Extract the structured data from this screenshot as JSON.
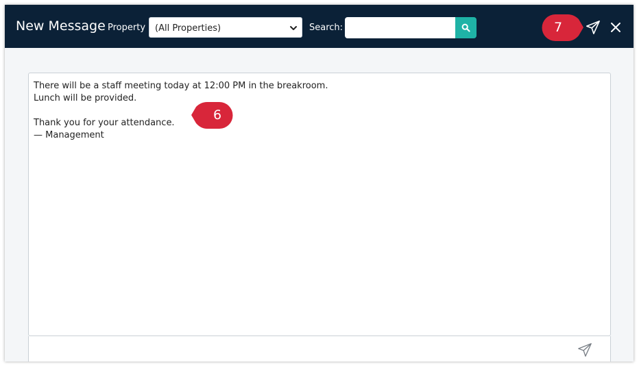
{
  "header": {
    "title": "New Message",
    "property_label": "Property",
    "property_selected": "(All Properties)",
    "search_label": "Search:",
    "search_value": "",
    "search_placeholder": ""
  },
  "callouts": {
    "send_step": "7",
    "message_step": "6"
  },
  "message": {
    "body": "There will be a staff meeting today at 12:00 PM in the breakroom.\nLunch will be provided.\n\nThank you for your attendance.\n— Management"
  },
  "icons": {
    "search": "search-icon",
    "send": "send-icon",
    "close": "close-icon",
    "chevron": "chevron-down-icon"
  },
  "colors": {
    "header_bg": "#0b2137",
    "accent_teal": "#1fb3a6",
    "callout_red": "#d8263a"
  }
}
